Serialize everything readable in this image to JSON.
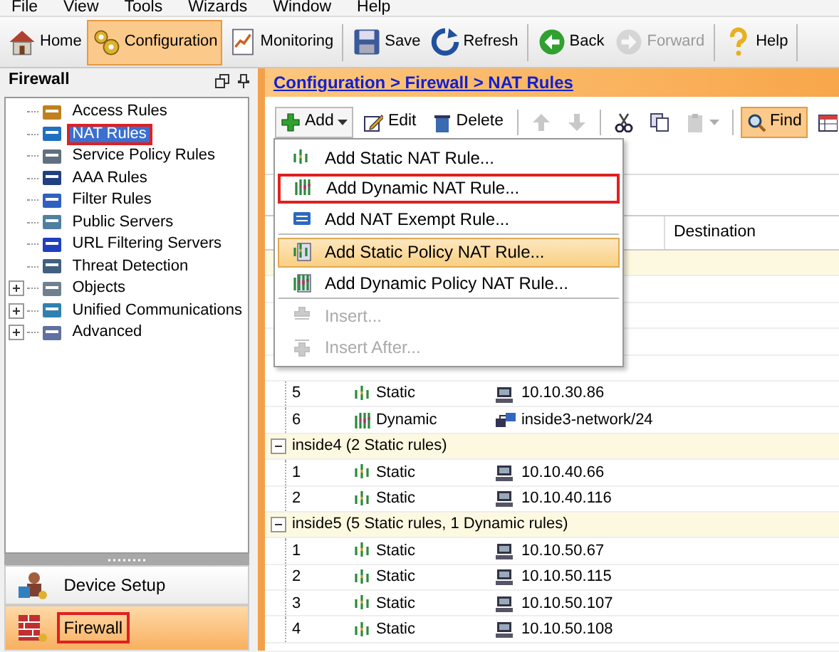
{
  "menu_bar": [
    "File",
    "View",
    "Tools",
    "Wizards",
    "Window",
    "Help"
  ],
  "toolbar": [
    {
      "label": "Home",
      "selected": false,
      "disabled": false
    },
    {
      "label": "Configuration",
      "selected": true,
      "disabled": false
    },
    {
      "label": "Monitoring",
      "selected": false,
      "disabled": false
    },
    {
      "label": "Save",
      "selected": false,
      "disabled": false
    },
    {
      "label": "Refresh",
      "selected": false,
      "disabled": false
    },
    {
      "label": "Back",
      "selected": false,
      "disabled": false
    },
    {
      "label": "Forward",
      "selected": false,
      "disabled": true
    },
    {
      "label": "Help",
      "selected": false,
      "disabled": false
    }
  ],
  "sidebar": {
    "title": "Firewall",
    "items": [
      {
        "label": "Access Rules",
        "selected": false,
        "annotated": false
      },
      {
        "label": "NAT Rules",
        "selected": true,
        "annotated": true
      },
      {
        "label": "Service Policy Rules",
        "selected": false,
        "annotated": false
      },
      {
        "label": "AAA Rules",
        "selected": false,
        "annotated": false
      },
      {
        "label": "Filter Rules",
        "selected": false,
        "annotated": false
      },
      {
        "label": "Public Servers",
        "selected": false,
        "annotated": false
      },
      {
        "label": "URL Filtering Servers",
        "selected": false,
        "annotated": false
      },
      {
        "label": "Threat Detection",
        "selected": false,
        "annotated": false
      },
      {
        "label": "Objects",
        "selected": false,
        "annotated": false,
        "expanded": false
      },
      {
        "label": "Unified Communications",
        "selected": false,
        "annotated": false,
        "expanded": false
      },
      {
        "label": "Advanced",
        "selected": false,
        "annotated": false,
        "expanded": false
      }
    ],
    "nav": [
      {
        "label": "Device Setup",
        "selected": false,
        "annotated": false
      },
      {
        "label": "Firewall",
        "selected": true,
        "annotated": true
      }
    ]
  },
  "breadcrumb": "Configuration > Firewall > NAT Rules",
  "rule_toolbar": [
    {
      "label": "Add",
      "selected": false,
      "disabled": false,
      "dropdown": true
    },
    {
      "label": "Edit",
      "selected": false,
      "disabled": false,
      "dropdown": false
    },
    {
      "label": "Delete",
      "selected": false,
      "disabled": false,
      "dropdown": false
    },
    {
      "selected": false,
      "disabled": true,
      "dropdown": false
    },
    {
      "selected": false,
      "disabled": true,
      "dropdown": false
    },
    {
      "selected": false,
      "disabled": false,
      "dropdown": false
    },
    {
      "selected": false,
      "disabled": false,
      "dropdown": false
    },
    {
      "selected": false,
      "disabled": true,
      "dropdown": true
    },
    {
      "label": "Find",
      "selected": true,
      "disabled": false,
      "dropdown": false
    },
    {
      "selected": false,
      "disabled": false,
      "dropdown": false
    }
  ],
  "add_menu": [
    {
      "label": "Add Static NAT Rule...",
      "selected": false,
      "disabled": false,
      "annotated": false,
      "separator_after": false
    },
    {
      "label": "Add Dynamic NAT Rule...",
      "selected": false,
      "disabled": false,
      "annotated": true,
      "separator_after": false
    },
    {
      "label": "Add NAT Exempt Rule...",
      "selected": false,
      "disabled": false,
      "annotated": false,
      "separator_after": true
    },
    {
      "label": "Add Static Policy NAT Rule...",
      "selected": true,
      "disabled": false,
      "annotated": false,
      "separator_after": false
    },
    {
      "label": "Add Dynamic Policy NAT Rule...",
      "selected": false,
      "disabled": false,
      "annotated": false,
      "separator_after": true
    },
    {
      "label": "Insert...",
      "selected": false,
      "disabled": true,
      "annotated": false,
      "separator_after": false
    },
    {
      "label": "Insert After...",
      "selected": false,
      "disabled": true,
      "annotated": false,
      "separator_after": false
    }
  ],
  "table": {
    "columns": [
      "Destination"
    ],
    "rows": [
      {
        "kind": "static",
        "number": "5",
        "type": "Static",
        "source": "10.10.30.86"
      },
      {
        "kind": "dynamic",
        "number": "6",
        "type": "Dynamic",
        "source": "inside3-network/24"
      },
      {
        "kind": "group",
        "label": "inside4 (2 Static rules)",
        "expanded": true
      },
      {
        "kind": "static",
        "number": "1",
        "type": "Static",
        "source": "10.10.40.66"
      },
      {
        "kind": "static",
        "number": "2",
        "type": "Static",
        "source": "10.10.40.116"
      },
      {
        "kind": "group",
        "label": "inside5 (5 Static rules, 1 Dynamic rules)",
        "expanded": true
      },
      {
        "kind": "static",
        "number": "1",
        "type": "Static",
        "source": "10.10.50.67"
      },
      {
        "kind": "static",
        "number": "2",
        "type": "Static",
        "source": "10.10.50.115"
      },
      {
        "kind": "static",
        "number": "3",
        "type": "Static",
        "source": "10.10.50.107"
      },
      {
        "kind": "static",
        "number": "4",
        "type": "Static",
        "source": "10.10.50.108"
      }
    ]
  }
}
